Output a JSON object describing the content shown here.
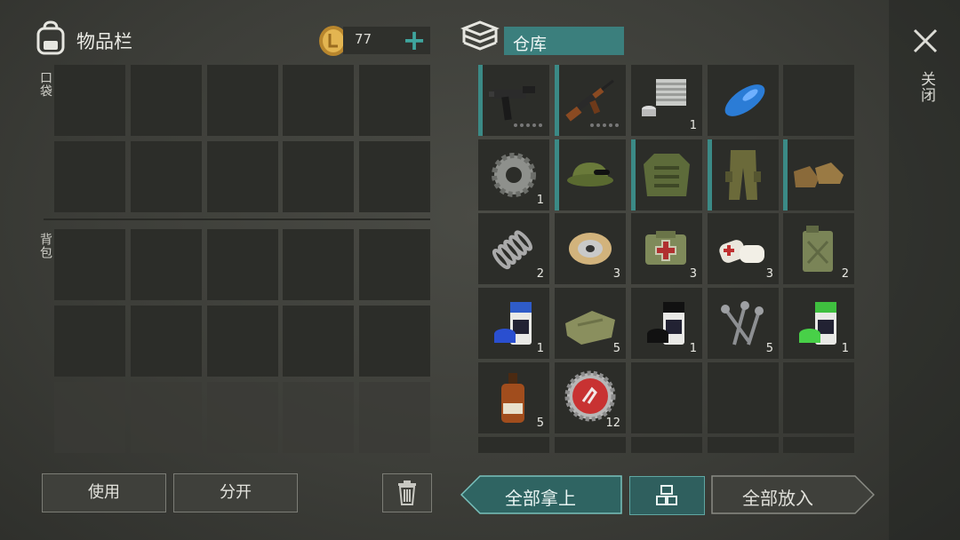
{
  "inventory": {
    "title": "物品栏",
    "pocket_label": "口袋",
    "backpack_label": "背包"
  },
  "currency": {
    "amount": "77",
    "add_symbol": "+"
  },
  "storage": {
    "title": "仓库",
    "items": [
      {
        "name": "uzi-smg-icon",
        "qty": ""
      },
      {
        "name": "ak-rifle-icon",
        "qty": ""
      },
      {
        "name": "engine-cylinder-icon",
        "qty": "1"
      },
      {
        "name": "blue-fuel-tank-icon",
        "qty": ""
      },
      {
        "name": "empty",
        "qty": ""
      },
      {
        "name": "gear-icon",
        "qty": "1"
      },
      {
        "name": "camo-cap-icon",
        "qty": ""
      },
      {
        "name": "camo-jacket-icon",
        "qty": ""
      },
      {
        "name": "camo-pants-icon",
        "qty": ""
      },
      {
        "name": "boots-icon",
        "qty": ""
      },
      {
        "name": "spring-icon",
        "qty": "2"
      },
      {
        "name": "wire-spool-icon",
        "qty": "3"
      },
      {
        "name": "medkit-bag-icon",
        "qty": "3"
      },
      {
        "name": "bandage-icon",
        "qty": "3"
      },
      {
        "name": "jerrycan-icon",
        "qty": "2"
      },
      {
        "name": "blue-paint-can-icon",
        "qty": "1"
      },
      {
        "name": "cloth-icon",
        "qty": "5"
      },
      {
        "name": "black-paint-can-icon",
        "qty": "1"
      },
      {
        "name": "nails-icon",
        "qty": "5"
      },
      {
        "name": "green-paint-can-icon",
        "qty": "1"
      },
      {
        "name": "bottle-icon",
        "qty": "5"
      },
      {
        "name": "bottle-cap-icon",
        "qty": "12"
      }
    ]
  },
  "close": {
    "label": "关闭"
  },
  "buttons": {
    "use": "使用",
    "split": "分开",
    "take_all": "全部拿上",
    "put_all": "全部放入"
  },
  "colors": {
    "accent": "#3b7f7d",
    "slot": "#2c2d29",
    "background": "#3d3e39"
  }
}
